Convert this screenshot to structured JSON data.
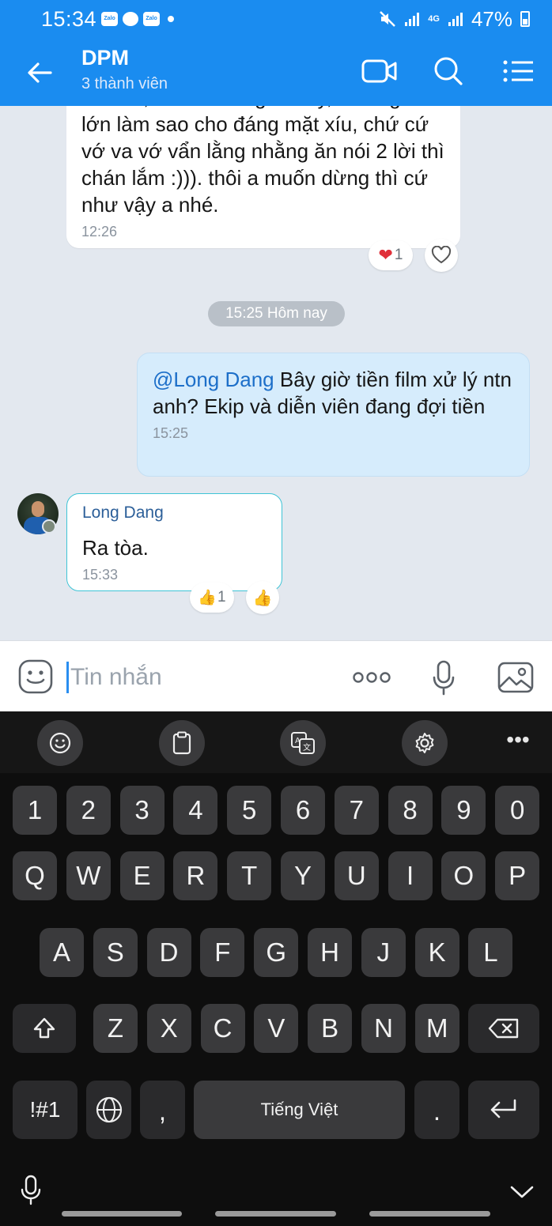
{
  "status_bar": {
    "time": "15:34",
    "apps": [
      "Zalo",
      "Zalo"
    ],
    "battery": "47%",
    "network": "4G"
  },
  "header": {
    "title": "DPM",
    "subtitle": "3 thành viên",
    "icons": [
      "back-arrow-icon",
      "video-call-icon",
      "search-icon",
      "menu-list-icon"
    ]
  },
  "messages": [
    {
      "text": "ok anh, mà ở nơi nghề này, anh người lớn làm sao cho đáng mặt xíu, chứ cứ vớ va vớ vẩn lằng nhằng ăn nói 2 lời thì chán lắm :))). thôi a muốn dừng thì cứ như vậy a nhé.",
      "time": "12:26",
      "reaction": {
        "emoji": "❤",
        "count": "1"
      }
    },
    {
      "date_chip": "15:25 Hôm nay"
    },
    {
      "mention": "@Long Dang",
      "text": "Bây giờ tiền film xử lý ntn anh? Ekip và diễn viên đang đợi tiền",
      "time": "15:25"
    },
    {
      "sender": "Long Dang",
      "text": "Ra tòa.",
      "time": "15:33",
      "reaction": {
        "emoji": "👍",
        "count": "1"
      }
    }
  ],
  "input": {
    "placeholder": "Tin nhắn"
  },
  "keyboard": {
    "number_row": [
      "1",
      "2",
      "3",
      "4",
      "5",
      "6",
      "7",
      "8",
      "9",
      "0"
    ],
    "row1": [
      "Q",
      "W",
      "E",
      "R",
      "T",
      "Y",
      "U",
      "I",
      "O",
      "P"
    ],
    "row2": [
      "A",
      "S",
      "D",
      "F",
      "G",
      "H",
      "J",
      "K",
      "L"
    ],
    "row3": [
      "Z",
      "X",
      "C",
      "V",
      "B",
      "N",
      "M"
    ],
    "symbols_key": "!#1",
    "comma_key": ",",
    "space_label": "Tiếng Việt",
    "period_key": "."
  },
  "colors": {
    "header": "#1a8cf0",
    "chat_bg": "#e3e8ef",
    "my_bubble": "#d6ecfc",
    "mention": "#1d6fc9",
    "keyboard_bg": "#0e0e0e"
  }
}
